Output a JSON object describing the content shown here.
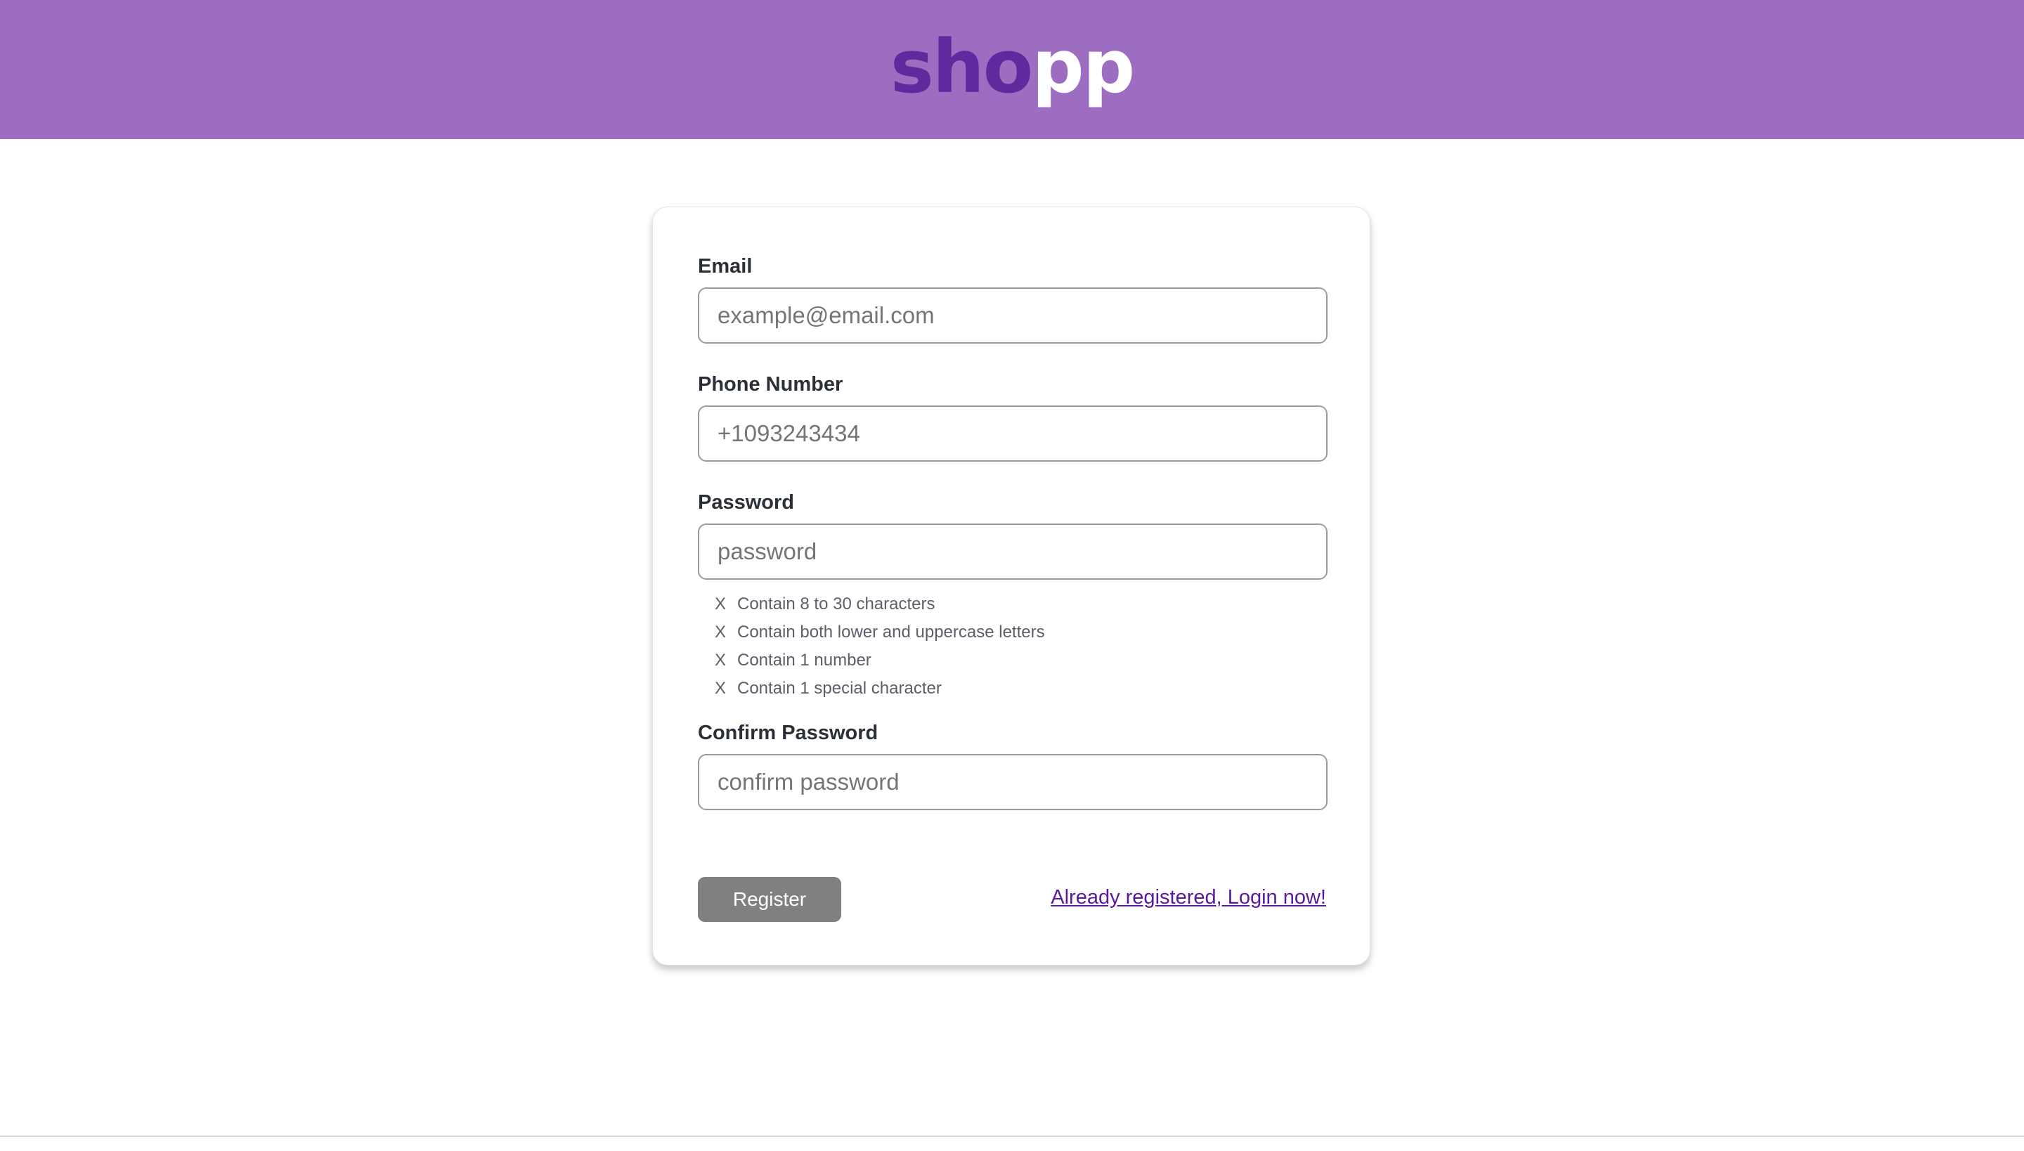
{
  "brand": {
    "logo_part1": "sho",
    "logo_part2": "pp",
    "logo_color_part1": "#5e2a9e",
    "logo_color_part2": "#ffffff",
    "header_color": "#9c6dc1"
  },
  "form": {
    "email": {
      "label": "Email",
      "placeholder": "example@email.com",
      "value": ""
    },
    "phone": {
      "label": "Phone Number",
      "placeholder": "+1093243434",
      "value": ""
    },
    "password": {
      "label": "Password",
      "placeholder": "password",
      "value": ""
    },
    "password_rules": [
      {
        "mark": "X",
        "text": "Contain 8 to 30 characters"
      },
      {
        "mark": "X",
        "text": "Contain both lower and uppercase letters"
      },
      {
        "mark": "X",
        "text": "Contain 1 number"
      },
      {
        "mark": "X",
        "text": "Contain 1 special character"
      }
    ],
    "confirm_password": {
      "label": "Confirm Password",
      "placeholder": "confirm password",
      "value": ""
    },
    "register_label": "Register",
    "login_link_text": "Already registered, Login now!"
  }
}
